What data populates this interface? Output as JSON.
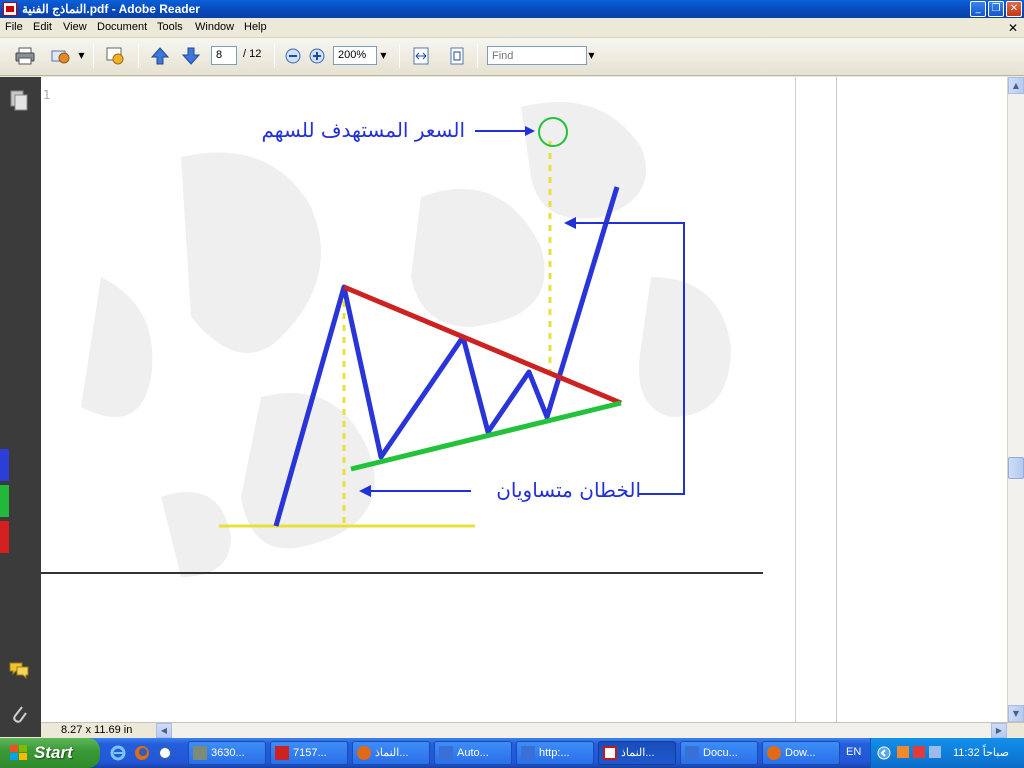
{
  "window": {
    "title": "النماذج الفنية.pdf - Adobe Reader",
    "minimize_glyph": "_",
    "maximize_glyph": "❐",
    "close_glyph": "✕"
  },
  "menu": {
    "items": [
      "File",
      "Edit",
      "View",
      "Document",
      "Tools",
      "Window",
      "Help"
    ],
    "close_document_glyph": "✕"
  },
  "toolbar": {
    "current_page": "8",
    "page_total": "/ 12",
    "zoom": "200%",
    "find_placeholder": "Find"
  },
  "document": {
    "label_target_price": "السعر المستهدف للسهم",
    "label_equal_lines": "الخطان متساويان",
    "page_corner_mark": "1"
  },
  "statusbar": {
    "page_size": "8.27 x 11.69 in"
  },
  "taskbar": {
    "start_label": "Start",
    "tasks": [
      {
        "label": "3630...",
        "active": false,
        "color": "#7a8b7a"
      },
      {
        "label": "7157...",
        "active": false,
        "color": "#cc2222"
      },
      {
        "label": "النماذ...",
        "active": false,
        "color": "#e06a15"
      },
      {
        "label": "Auto...",
        "active": false,
        "color": "#3870d8"
      },
      {
        "label": "http:...",
        "active": false,
        "color": "#3870d8"
      },
      {
        "label": "النماذ...",
        "active": true,
        "color": "#c41a1a"
      },
      {
        "label": "Docu...",
        "active": false,
        "color": "#3870d8"
      },
      {
        "label": "Dow...",
        "active": false,
        "color": "#e06a15"
      }
    ],
    "language": "EN",
    "clock": "11:32 صباحاً"
  },
  "colors": {
    "price_line": "#2a35d8",
    "resistance": "#cc2222",
    "support": "#22c33a",
    "guide": "#e8e03a",
    "label_text": "#2231d6",
    "nav_panel": "#3b3b3b"
  }
}
